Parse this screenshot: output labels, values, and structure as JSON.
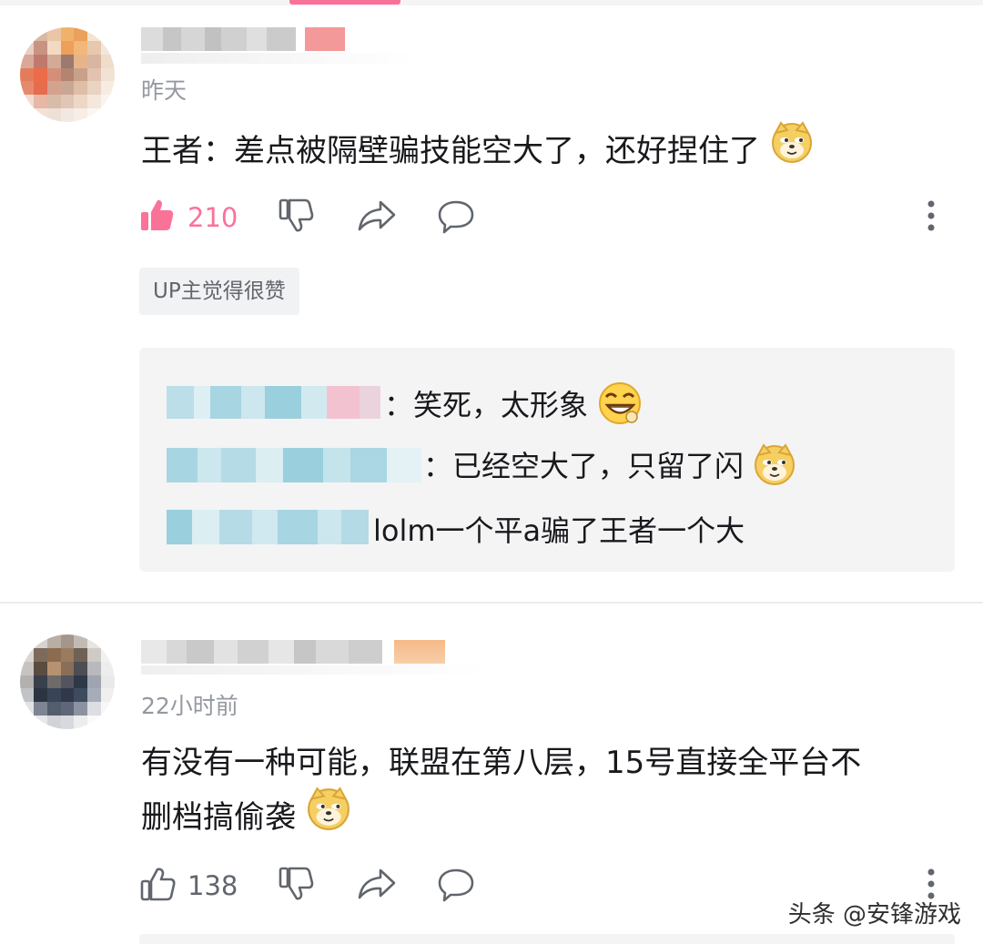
{
  "colors": {
    "accent": "#fb7299",
    "text_primary": "#18191c",
    "text_secondary": "#9499a0",
    "icon_gray": "#61666d"
  },
  "comments": [
    {
      "time": "昨天",
      "text": "王者：差点被隔壁骗技能空大了，还好捏住了",
      "emoji": "doge-emoji",
      "like_count": "210",
      "liked": true,
      "up_badge": "UP主觉得很赞",
      "replies": [
        {
          "text": "：笑死，太形象",
          "emoji": "grin-emoji"
        },
        {
          "text": "：已经空大了，只留了闪",
          "emoji": "doge-emoji"
        },
        {
          "text": "lolm一个平a骗了王者一个大",
          "emoji": ""
        }
      ]
    },
    {
      "time": "22小时前",
      "text_line1": "有没有一种可能，联盟在第八层，15号直接全平台不",
      "text_line2": "删档搞偷袭",
      "emoji": "doge-emoji",
      "like_count": "138",
      "liked": false
    }
  ],
  "icons": [
    "thumb-up-icon",
    "thumb-down-icon",
    "share-icon",
    "reply-icon",
    "more-icon"
  ],
  "watermark": "头条 @安锋游戏"
}
